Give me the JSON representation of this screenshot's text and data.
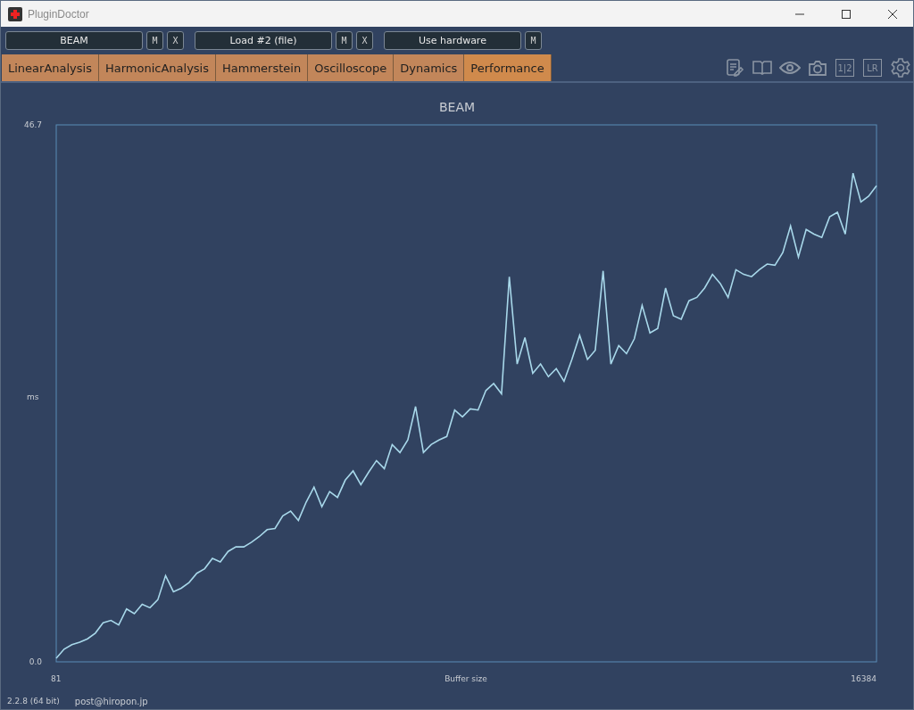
{
  "window": {
    "title": "PluginDoctor"
  },
  "slots": [
    {
      "label": "BEAM",
      "buttons": [
        "M",
        "X"
      ]
    },
    {
      "label": "Load #2 (file)",
      "buttons": [
        "M",
        "X"
      ]
    },
    {
      "label": "Use hardware",
      "buttons": [
        "M"
      ]
    }
  ],
  "tabs": [
    {
      "label": "LinearAnalysis",
      "selected": false
    },
    {
      "label": "HarmonicAnalysis",
      "selected": false
    },
    {
      "label": "Hammerstein",
      "selected": false
    },
    {
      "label": "Oscilloscope",
      "selected": false
    },
    {
      "label": "Dynamics",
      "selected": false
    },
    {
      "label": "Performance",
      "selected": true
    }
  ],
  "toolbar": {
    "split_label": "1|2",
    "lr_label": "LR"
  },
  "chart": {
    "x_start_label": "81",
    "x_end_label": "16384",
    "chart_data": {
      "type": "line",
      "title": "BEAM",
      "xlabel": "Buffer size",
      "ylabel": "ms",
      "ylim": [
        0,
        46.7
      ],
      "yticks": [
        {
          "value": 0,
          "label": "0.0"
        },
        {
          "value": 46.7,
          "label": "46.7"
        }
      ],
      "series": [
        {
          "color": "#a8d8ea",
          "values": [
            0.3,
            1.1,
            1.5,
            1.7,
            2.0,
            2.5,
            3.4,
            3.6,
            3.2,
            4.6,
            4.2,
            5.0,
            4.7,
            5.4,
            7.5,
            6.1,
            6.4,
            6.9,
            7.7,
            8.1,
            9.0,
            8.7,
            9.6,
            10.0,
            10.0,
            10.4,
            10.9,
            11.5,
            11.6,
            12.7,
            13.1,
            12.3,
            13.9,
            15.2,
            13.5,
            14.8,
            14.3,
            15.8,
            16.6,
            15.4,
            16.5,
            17.5,
            16.8,
            18.9,
            18.2,
            19.3,
            22.2,
            18.2,
            18.9,
            19.3,
            19.6,
            21.9,
            21.3,
            22.0,
            21.9,
            23.6,
            24.2,
            23.3,
            33.5,
            25.9,
            28.2,
            25.1,
            25.9,
            24.8,
            25.5,
            24.4,
            26.3,
            28.4,
            26.3,
            27.1,
            34.0,
            25.9,
            27.5,
            26.8,
            28.1,
            31.0,
            28.6,
            29.0,
            32.5,
            30.1,
            29.8,
            31.4,
            31.7,
            32.5,
            33.7,
            32.9,
            31.7,
            34.1,
            33.7,
            33.5,
            34.1,
            34.6,
            34.5,
            35.6,
            37.9,
            35.2,
            37.6,
            37.2,
            36.9,
            38.7,
            39.1,
            37.2,
            42.5,
            40.0,
            40.5,
            41.4
          ]
        }
      ]
    }
  },
  "status_bar": {
    "version": "2.2.8 (64 bit)",
    "email": "post@hiropon.jp"
  }
}
